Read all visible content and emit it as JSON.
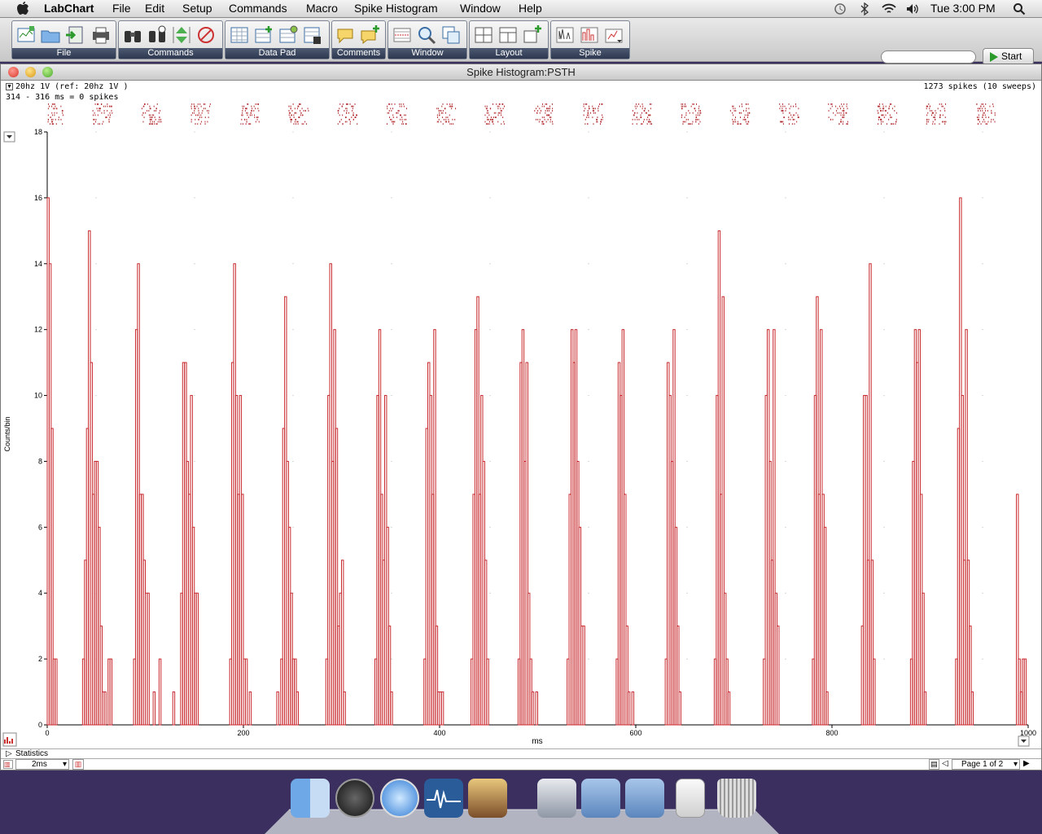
{
  "menubar": {
    "app_name": "LabChart",
    "items": [
      "File",
      "Edit",
      "Setup",
      "Commands",
      "Macro",
      "Spike Histogram",
      "Window",
      "Help"
    ],
    "clock": "Tue 3:00 PM",
    "icons": [
      "time-machine-icon",
      "bluetooth-icon",
      "wifi-icon",
      "volume-icon",
      "spotlight-icon"
    ]
  },
  "toolbar": {
    "groups": [
      {
        "label": "File",
        "icons": [
          "new-document-icon",
          "open-folder-icon",
          "import-icon",
          "print-icon"
        ]
      },
      {
        "label": "Commands",
        "icons": [
          "binoculars-icon",
          "binoculars-find-icon",
          "marker-icon",
          "no-marker-icon"
        ]
      },
      {
        "label": "Data Pad",
        "icons": [
          "data-pad-icon",
          "add-to-data-pad-icon",
          "data-pad-setup-icon",
          "data-pad-view-icon"
        ]
      },
      {
        "label": "Comments",
        "icons": [
          "comment-icon",
          "add-comment-icon"
        ]
      },
      {
        "label": "Window",
        "icons": [
          "chart-view-icon",
          "zoom-view-icon",
          "overlay-view-icon"
        ]
      },
      {
        "label": "Layout",
        "icons": [
          "layout-grid-icon",
          "layout-split-icon",
          "add-pane-icon"
        ]
      },
      {
        "label": "Spike",
        "icons": [
          "spike-settings-icon",
          "spike-histogram-icon",
          "spike-menu-icon"
        ]
      }
    ],
    "start_label": "Start"
  },
  "window": {
    "title": "Spike Histogram:PSTH",
    "channel_label": "20hz 1V (ref: 20hz 1V )",
    "selection_info": "314 - 316 ms = 0 spikes",
    "spike_count": "1273 spikes (10 sweeps)",
    "statistics_label": "Statistics",
    "bin_width": "2ms",
    "page_label": "Page 1 of 2"
  },
  "colors": {
    "bars": "#c8282c",
    "raster": "#b0282c",
    "accent": "#2d3850"
  },
  "chart_data": {
    "type": "bar",
    "xlabel": "ms",
    "ylabel": "Counts/bin",
    "xlim": [
      0,
      1000
    ],
    "ylim": [
      0,
      18
    ],
    "xticks": [
      0,
      200,
      400,
      600,
      800,
      1000
    ],
    "yticks": [
      0,
      2,
      4,
      6,
      8,
      10,
      12,
      14,
      16,
      18
    ],
    "bin_width_ms": 2,
    "burst_centers_ms": [
      0,
      50,
      100,
      150,
      200,
      250,
      300,
      350,
      400,
      450,
      500,
      550,
      600,
      650,
      700,
      750,
      800,
      850,
      900,
      950
    ],
    "burst_peaks": [
      16,
      15,
      14,
      11,
      14,
      13,
      14,
      12,
      12,
      13,
      12,
      12,
      12,
      12,
      15,
      12,
      13,
      14,
      12,
      16
    ],
    "series": [
      {
        "values": [
          [
            0,
            16
          ],
          [
            2,
            14
          ],
          [
            4,
            9
          ],
          [
            6,
            2
          ],
          [
            8,
            2
          ],
          [
            36,
            2
          ],
          [
            38,
            5
          ],
          [
            40,
            9
          ],
          [
            42,
            15
          ],
          [
            44,
            11
          ],
          [
            46,
            7
          ],
          [
            48,
            8
          ],
          [
            50,
            8
          ],
          [
            52,
            6
          ],
          [
            54,
            3
          ],
          [
            56,
            1
          ],
          [
            58,
            1
          ],
          [
            62,
            2
          ],
          [
            64,
            2
          ],
          [
            88,
            2
          ],
          [
            90,
            12
          ],
          [
            92,
            14
          ],
          [
            94,
            7
          ],
          [
            96,
            7
          ],
          [
            98,
            5
          ],
          [
            100,
            4
          ],
          [
            102,
            4
          ],
          [
            108,
            1
          ],
          [
            114,
            2
          ],
          [
            128,
            1
          ],
          [
            136,
            4
          ],
          [
            138,
            11
          ],
          [
            140,
            11
          ],
          [
            142,
            8
          ],
          [
            144,
            7
          ],
          [
            146,
            10
          ],
          [
            148,
            6
          ],
          [
            150,
            4
          ],
          [
            152,
            4
          ],
          [
            186,
            2
          ],
          [
            188,
            11
          ],
          [
            190,
            14
          ],
          [
            192,
            10
          ],
          [
            194,
            7
          ],
          [
            196,
            10
          ],
          [
            198,
            7
          ],
          [
            200,
            2
          ],
          [
            202,
            2
          ],
          [
            206,
            1
          ],
          [
            234,
            1
          ],
          [
            238,
            2
          ],
          [
            240,
            9
          ],
          [
            242,
            13
          ],
          [
            244,
            8
          ],
          [
            246,
            6
          ],
          [
            248,
            4
          ],
          [
            250,
            2
          ],
          [
            252,
            2
          ],
          [
            254,
            1
          ],
          [
            284,
            2
          ],
          [
            286,
            10
          ],
          [
            288,
            14
          ],
          [
            290,
            8
          ],
          [
            292,
            12
          ],
          [
            294,
            9
          ],
          [
            296,
            3
          ],
          [
            298,
            4
          ],
          [
            300,
            5
          ],
          [
            302,
            1
          ],
          [
            334,
            2
          ],
          [
            336,
            10
          ],
          [
            338,
            12
          ],
          [
            340,
            7
          ],
          [
            342,
            5
          ],
          [
            344,
            10
          ],
          [
            346,
            6
          ],
          [
            348,
            3
          ],
          [
            350,
            1
          ],
          [
            384,
            2
          ],
          [
            386,
            9
          ],
          [
            388,
            11
          ],
          [
            390,
            10
          ],
          [
            392,
            7
          ],
          [
            394,
            12
          ],
          [
            396,
            3
          ],
          [
            398,
            1
          ],
          [
            400,
            1
          ],
          [
            402,
            1
          ],
          [
            432,
            2
          ],
          [
            434,
            7
          ],
          [
            436,
            12
          ],
          [
            438,
            13
          ],
          [
            440,
            7
          ],
          [
            442,
            10
          ],
          [
            444,
            8
          ],
          [
            446,
            5
          ],
          [
            448,
            2
          ],
          [
            480,
            2
          ],
          [
            482,
            11
          ],
          [
            484,
            12
          ],
          [
            486,
            8
          ],
          [
            488,
            11
          ],
          [
            490,
            4
          ],
          [
            492,
            2
          ],
          [
            494,
            1
          ],
          [
            498,
            1
          ],
          [
            530,
            2
          ],
          [
            532,
            7
          ],
          [
            534,
            12
          ],
          [
            536,
            11
          ],
          [
            538,
            12
          ],
          [
            540,
            8
          ],
          [
            542,
            6
          ],
          [
            544,
            3
          ],
          [
            546,
            3
          ],
          [
            580,
            2
          ],
          [
            582,
            11
          ],
          [
            584,
            10
          ],
          [
            586,
            12
          ],
          [
            588,
            7
          ],
          [
            590,
            3
          ],
          [
            592,
            1
          ],
          [
            596,
            1
          ],
          [
            630,
            2
          ],
          [
            632,
            11
          ],
          [
            634,
            10
          ],
          [
            636,
            8
          ],
          [
            638,
            12
          ],
          [
            640,
            6
          ],
          [
            642,
            3
          ],
          [
            644,
            1
          ],
          [
            680,
            2
          ],
          [
            682,
            10
          ],
          [
            684,
            15
          ],
          [
            686,
            7
          ],
          [
            688,
            13
          ],
          [
            690,
            4
          ],
          [
            692,
            2
          ],
          [
            694,
            1
          ],
          [
            730,
            2
          ],
          [
            732,
            10
          ],
          [
            734,
            12
          ],
          [
            736,
            8
          ],
          [
            738,
            5
          ],
          [
            740,
            12
          ],
          [
            742,
            4
          ],
          [
            744,
            3
          ],
          [
            780,
            2
          ],
          [
            782,
            10
          ],
          [
            784,
            13
          ],
          [
            786,
            7
          ],
          [
            788,
            12
          ],
          [
            790,
            7
          ],
          [
            792,
            6
          ],
          [
            794,
            1
          ],
          [
            830,
            3
          ],
          [
            832,
            10
          ],
          [
            834,
            10
          ],
          [
            836,
            5
          ],
          [
            838,
            14
          ],
          [
            840,
            5
          ],
          [
            842,
            2
          ],
          [
            880,
            2
          ],
          [
            882,
            8
          ],
          [
            884,
            12
          ],
          [
            886,
            11
          ],
          [
            888,
            12
          ],
          [
            890,
            7
          ],
          [
            892,
            4
          ],
          [
            894,
            1
          ],
          [
            926,
            2
          ],
          [
            928,
            9
          ],
          [
            930,
            16
          ],
          [
            932,
            10
          ],
          [
            934,
            5
          ],
          [
            936,
            12
          ],
          [
            938,
            5
          ],
          [
            940,
            3
          ],
          [
            942,
            1
          ],
          [
            988,
            7
          ],
          [
            990,
            2
          ],
          [
            992,
            1
          ],
          [
            994,
            2
          ],
          [
            996,
            2
          ]
        ]
      }
    ]
  }
}
